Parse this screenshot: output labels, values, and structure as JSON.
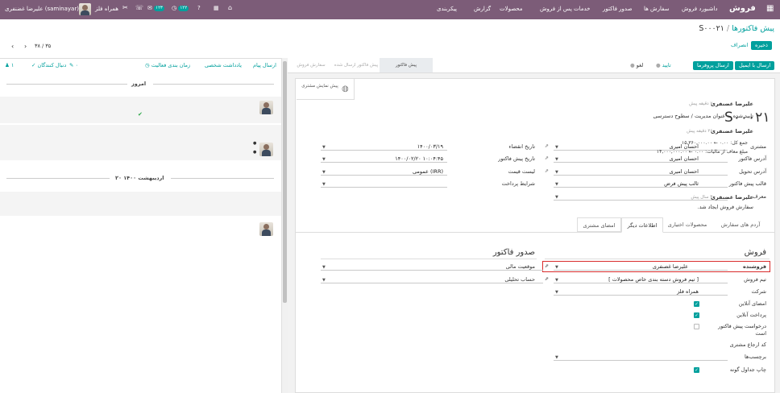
{
  "navbar": {
    "app_name": "فروش",
    "menu": [
      "داشبورد فروش",
      "سفارش ها",
      "صدور فاکتور",
      "خدمات پس از فروش",
      "محصولات",
      "گزارش",
      "پیکربندی"
    ],
    "user_name": "علیرضا غضنفری (saminayar)",
    "company": "همراه فلز",
    "activity_badge": "۱۲۲",
    "message_badge": "۱۲۳"
  },
  "breadcrumb": {
    "parent": "پیش فاکتورها",
    "sep": "/",
    "current": "S۰۰۰۲۱"
  },
  "actions": {
    "save": "ذخیره",
    "discard": "انصراف"
  },
  "pager": {
    "value": "۳۸ / ۳۵"
  },
  "statusbar": {
    "buttons": {
      "send_email": "ارسال با ایمیل",
      "send_proforma": "ارسال پروفرما",
      "confirm": "تایید",
      "cancel": "لغو"
    },
    "stages": [
      "پیش فاکتور",
      "پیش فاکتور ارسال شده",
      "سفارش فروش"
    ]
  },
  "smart_button": {
    "label": "پیش نمایش مشتری"
  },
  "order": {
    "name": "S۰۰۰۲۱"
  },
  "fields_right": [
    {
      "label": "مشتری",
      "value": "احسان امیری"
    },
    {
      "label": "آدرس فاکتور",
      "value": "احسان امیری"
    },
    {
      "label": "آدرس تحویل",
      "value": "احسان امیری"
    },
    {
      "label": "قالب پیش فاکتور",
      "value": "ثالب پیش فرض"
    },
    {
      "label": "معرف",
      "value": ""
    }
  ],
  "fields_left": [
    {
      "label": "تاریخ انقضاء",
      "value": "۱۴۰۰/۰۳/۱۹"
    },
    {
      "label": "تاریخ پیش فاکتور",
      "value": "۱۴۰۰/۰۲/۲۰ ۱۰:۰۴:۴۵"
    },
    {
      "label": "لیست قیمت",
      "value": "عمومی (IRR)"
    },
    {
      "label": "شرایط پرداخت",
      "value": ""
    }
  ],
  "tabs": [
    "آردم های سفارش",
    "محصولات اختیاری",
    "اطلاعات دیگر",
    "امضای مشتری"
  ],
  "section_sales": {
    "title": "فروش",
    "fields": [
      {
        "label": "فروشنده",
        "value": "علیرضا غضنفری"
      },
      {
        "label": "تیم فروش",
        "value": "[ تیم فروش دسته بندی خاص محصولات ]"
      },
      {
        "label": "شرکت",
        "value": "همراه فلز"
      }
    ],
    "checks": [
      {
        "label": "امضای آنلاین",
        "checked": true
      },
      {
        "label": "پرداخت آنلاین",
        "checked": true
      },
      {
        "label": "درخواست پیش فاکتور است",
        "checked": false
      }
    ],
    "extra": [
      {
        "label": "کد ارجاع مشتری",
        "value": ""
      },
      {
        "label": "برچسب‌ها",
        "value": ""
      }
    ],
    "print_variants": {
      "label": "چاپ جداول گونه",
      "checked": true
    }
  },
  "section_invoicing": {
    "title": "صدور فاکتور",
    "fields": [
      {
        "label": "موقعیت مالی",
        "value": ""
      },
      {
        "label": "حساب تحلیلی",
        "value": ""
      }
    ]
  },
  "chatter": {
    "send_message": "ارسال پیام",
    "log_note": "یادداشت شخصی",
    "schedule_activity": "زمان بندی فعالیت",
    "attachments": "۰",
    "follow": "دنبال کنندگان",
    "followers_count": "۱",
    "sep_today": "امروز",
    "sep_old": "۲۰ اردیبهشت ۱۴۰۰",
    "messages": [
      {
        "author": "علیرضا غضنفری",
        "time": "- ۷ دقیقه پیش",
        "lines": [
          "تایید شده به عنوان مدیریت / سطوح دسترسی"
        ]
      },
      {
        "author": "علیرضا غضنفری",
        "time": "- ۲۶ دقیقه پیش",
        "lines": [
          "جمع کل: ۰.۰۰ ← ۱۵,۳۶۰,۰۰۰.۰۰",
          "مبلغ معاف از مالیات: ۰.۰۰ ← ۱۴,۰۰۰,۰۰۰.۰۰"
        ]
      },
      {
        "author": "علیرضا غضنفری",
        "time": "- ۳ سال پیش",
        "lines": [
          "سفارش فروش ایجاد شد."
        ]
      }
    ]
  }
}
